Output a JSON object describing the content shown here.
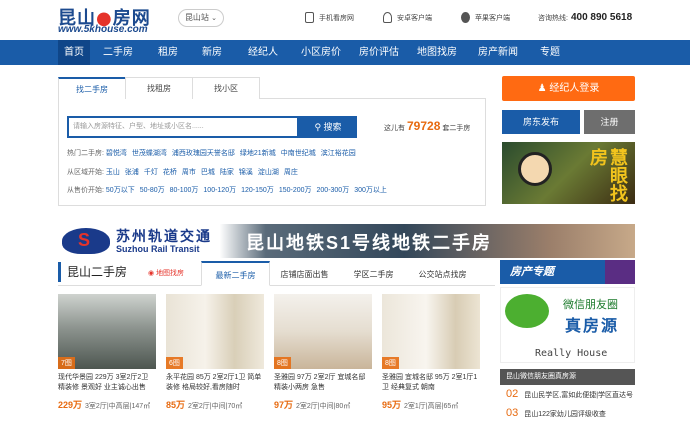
{
  "header": {
    "logo_a": "昆山",
    "logo_b": "房网",
    "logo_url": "www.5khouse.com",
    "city": "昆山站",
    "city_arrow": "⌄",
    "downloads": [
      {
        "label": "手机看房网"
      },
      {
        "label": "安卓客户端"
      },
      {
        "label": "苹果客户端"
      }
    ],
    "phone_label": "咨询热线:",
    "phone": "400 890 5618"
  },
  "nav": [
    "首页",
    "二手房",
    "租房",
    "新房",
    "经纪人",
    "小区房价",
    "房价评估",
    "地图找房",
    "房产新闻",
    "专题"
  ],
  "search": {
    "tabs": [
      "找二手房",
      "找租房",
      "找小区"
    ],
    "placeholder": "请输入房源特征、户型、地址或小区名......",
    "button": "搜索",
    "count_pre": "这儿有",
    "count": "79728",
    "count_post": "套二手房",
    "filters": [
      {
        "label": "热门二手房:",
        "links": [
          "碧悦湾",
          "世茂蝶湖湾",
          "浦西玫瑰园",
          "天誉名邸",
          "绿地21新城",
          "中南世纪城",
          "滨江裕花园"
        ]
      },
      {
        "label": "从区域开始:",
        "links": [
          "玉山",
          "张浦",
          "千灯",
          "花桥",
          "周市",
          "巴城",
          "陆家",
          "锦溪",
          "淀山湖",
          "周庄"
        ]
      },
      {
        "label": "从售价开始:",
        "links": [
          "50万以下",
          "50-80万",
          "80-100万",
          "100-120万",
          "120-150万",
          "150-200万",
          "200-300万",
          "300万以上"
        ]
      }
    ]
  },
  "right": {
    "agent_login": "经纪人登录",
    "publish": "房东发布",
    "register": "注册",
    "ad_text": "慧眼找房"
  },
  "banner": {
    "cn": "苏州轨道交通",
    "en": "Suzhou Rail Transit",
    "big": "昆山地铁S1号线地铁二手房"
  },
  "listings": {
    "title": "昆山二手房",
    "map_link": "地图找房",
    "tabs": [
      "最新二手房",
      "店铺店面出售",
      "学区二手房",
      "公交站点找房"
    ],
    "cards": [
      {
        "badge": "7图",
        "title": "现代华景园 229万 3室2厅2卫 精装修 景观好 业主诚心出售",
        "price": "229万",
        "info": "3室2厅|中高层|147㎡"
      },
      {
        "badge": "6图",
        "title": "永平花园 85万 2室2厅1卫 简单装修 格局较好,看房随时",
        "price": "85万",
        "info": "2室2厅|中间|70㎡"
      },
      {
        "badge": "8图",
        "title": "圣雅园 97万 2室2厅 宜城名邸 精装小两房 急售",
        "price": "97万",
        "info": "2室2厅|中间|80㎡"
      },
      {
        "badge": "8图",
        "title": "圣雅园 宜城名邸 95万 2室1厅1卫 经典复式 朝南",
        "price": "95万",
        "info": "2室1厅|高层|65㎡"
      }
    ]
  },
  "side": {
    "hot_title": "房产专题",
    "wx_line1": "微信朋友圈",
    "wx_line2": "真房源",
    "wx_line3": "Really House",
    "group_title": "昆山微信朋友圈真房源",
    "group_items": [
      {
        "n": "02",
        "t": "昆山民学区,富如此便捷|学区直达号"
      },
      {
        "n": "03",
        "t": "昆山122家幼儿园评级收查"
      }
    ]
  }
}
